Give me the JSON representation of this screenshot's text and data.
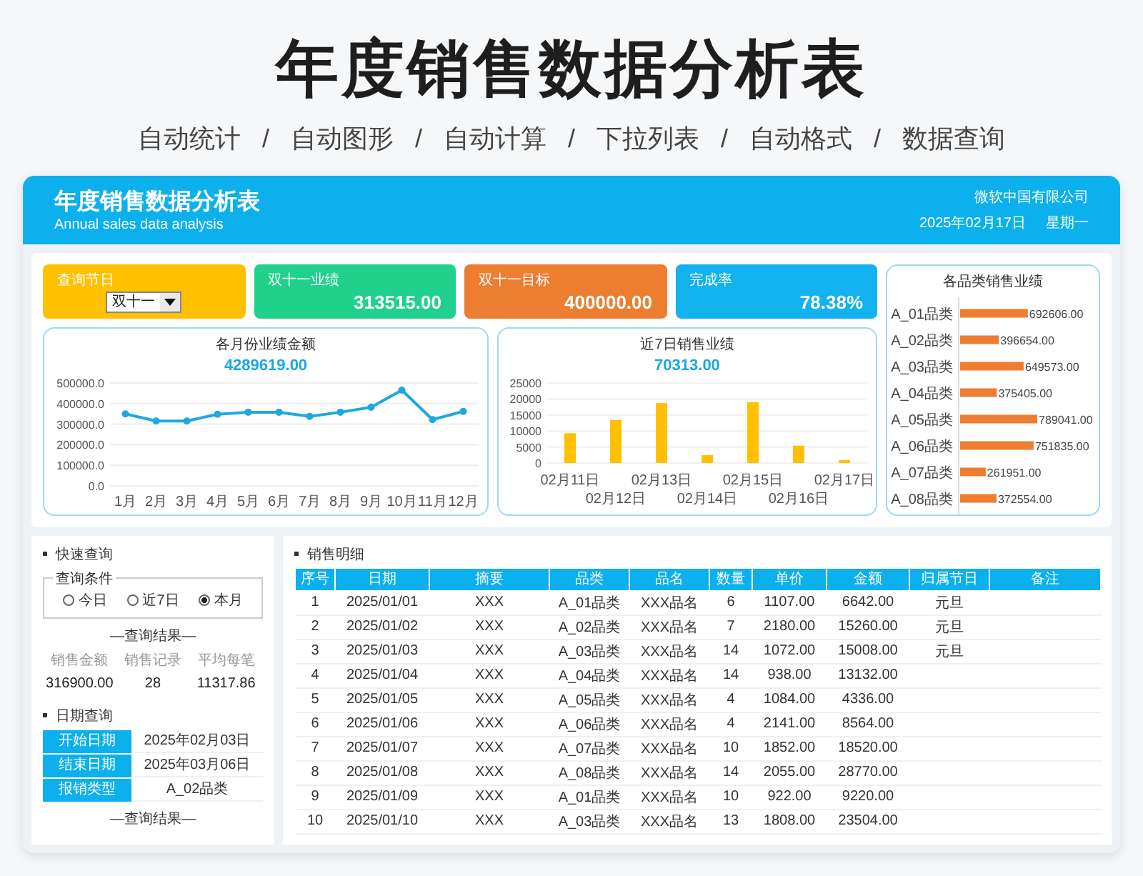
{
  "headline": {
    "title": "年度销售数据分析表",
    "features": "自动统计 / 自动图形 / 自动计算 / 下拉列表 / 自动格式 / 数据查询"
  },
  "header": {
    "title": "年度销售数据分析表",
    "subtitle": "Annual sales data analysis",
    "company": "微软中国有限公司",
    "date": "2025年02月17日",
    "weekday": "星期一"
  },
  "kpis": [
    {
      "kind": "select",
      "label": "查询节日",
      "value": "双十一",
      "color": "#ffc000"
    },
    {
      "kind": "metric",
      "label": "双十一业绩",
      "value": "313515.00",
      "color": "#1fd18a"
    },
    {
      "kind": "metric",
      "label": "双十一目标",
      "value": "400000.00",
      "color": "#ed7d31"
    },
    {
      "kind": "metric",
      "label": "完成率",
      "value": "78.38%",
      "color": "#12b2ee"
    }
  ],
  "monthly_chart": {
    "total": "4289619.00",
    "chart_data": {
      "type": "line",
      "title": "各月份业绩金额",
      "categories": [
        "1月",
        "2月",
        "3月",
        "4月",
        "5月",
        "6月",
        "7月",
        "8月",
        "9月",
        "10月",
        "11月",
        "12月"
      ],
      "grid": true,
      "series": [
        {
          "color": "#1fa8e0",
          "marker": true,
          "values": [
            350000,
            315000,
            315000,
            348000,
            358000,
            358000,
            338000,
            358000,
            382000,
            465000,
            322000,
            362000
          ]
        }
      ],
      "ylim": [
        0,
        500000
      ],
      "yticks": [
        {
          "value": 0,
          "label": "0.0"
        },
        {
          "value": 100000,
          "label": "100000.0"
        },
        {
          "value": 200000,
          "label": "200000.0"
        },
        {
          "value": 300000,
          "label": "300000.0"
        },
        {
          "value": 400000,
          "label": "400000.0"
        },
        {
          "value": 500000,
          "label": "500000.0"
        }
      ]
    }
  },
  "daily_chart": {
    "total": "70313.00",
    "chart_data": {
      "type": "bar",
      "title": "近7日销售业绩",
      "categories": [
        "02月11日",
        "02月12日",
        "02月13日",
        "02月14日",
        "02月15日",
        "02月16日",
        "02月17日"
      ],
      "grid": true,
      "series": [
        {
          "color": "#ffc000",
          "values": [
            9300,
            13400,
            18700,
            2500,
            19000,
            5400,
            900
          ]
        }
      ],
      "ylim": [
        0,
        25000
      ],
      "yticks": [
        0,
        5000,
        10000,
        15000,
        20000,
        25000
      ]
    }
  },
  "category_chart": {
    "chart_data": {
      "type": "bar",
      "orientation": "horizontal",
      "title": "各品类销售业绩",
      "categories": [
        "A_01品类",
        "A_02品类",
        "A_03品类",
        "A_04品类",
        "A_05品类",
        "A_06品类",
        "A_07品类",
        "A_08品类"
      ],
      "series": [
        {
          "color": "#ed7d31",
          "values": [
            692606,
            396654,
            649573,
            375405,
            789041,
            751835,
            261951,
            372554
          ],
          "value_labels": [
            "692606.00",
            "396654.00",
            "649573.00",
            "375405.00",
            "789041.00",
            "751835.00",
            "261951.00",
            "372554.00"
          ]
        }
      ]
    }
  },
  "quick_query": {
    "title": "快速查询",
    "legend": "查询条件",
    "options": [
      {
        "label": "今日",
        "selected": false
      },
      {
        "label": "近7日",
        "selected": false
      },
      {
        "label": "本月",
        "selected": true
      }
    ],
    "result_title": "—查询结果—",
    "metrics": [
      {
        "label": "销售金额",
        "value": "316900.00"
      },
      {
        "label": "销售记录",
        "value": "28"
      },
      {
        "label": "平均每笔",
        "value": "11317.86"
      }
    ]
  },
  "date_query": {
    "title": "日期查询",
    "fields": [
      {
        "label": "开始日期",
        "value": "2025年02月03日"
      },
      {
        "label": "结束日期",
        "value": "2025年03月06日"
      },
      {
        "label": "报销类型",
        "value": "A_02品类"
      }
    ],
    "result_title": "—查询结果—"
  },
  "sales_table": {
    "title": "销售明细",
    "columns": [
      "序号",
      "日期",
      "摘要",
      "品类",
      "品名",
      "数量",
      "单价",
      "金额",
      "归属节日",
      "备注"
    ],
    "rows": [
      [
        "1",
        "2025/01/01",
        "XXX",
        "A_01品类",
        "XXX品名",
        "6",
        "1107.00",
        "6642.00",
        "元旦"
      ],
      [
        "2",
        "2025/01/02",
        "XXX",
        "A_02品类",
        "XXX品名",
        "7",
        "2180.00",
        "15260.00",
        "元旦"
      ],
      [
        "3",
        "2025/01/03",
        "XXX",
        "A_03品类",
        "XXX品名",
        "14",
        "1072.00",
        "15008.00",
        "元旦"
      ],
      [
        "4",
        "2025/01/04",
        "XXX",
        "A_04品类",
        "XXX品名",
        "14",
        "938.00",
        "13132.00"
      ],
      [
        "5",
        "2025/01/05",
        "XXX",
        "A_05品类",
        "XXX品名",
        "4",
        "1084.00",
        "4336.00"
      ],
      [
        "6",
        "2025/01/06",
        "XXX",
        "A_06品类",
        "XXX品名",
        "4",
        "2141.00",
        "8564.00"
      ],
      [
        "7",
        "2025/01/07",
        "XXX",
        "A_07品类",
        "XXX品名",
        "10",
        "1852.00",
        "18520.00"
      ],
      [
        "8",
        "2025/01/08",
        "XXX",
        "A_08品类",
        "XXX品名",
        "14",
        "2055.00",
        "28770.00"
      ],
      [
        "9",
        "2025/01/09",
        "XXX",
        "A_01品类",
        "XXX品名",
        "10",
        "922.00",
        "9220.00"
      ],
      [
        "10",
        "2025/01/10",
        "XXX",
        "A_03品类",
        "XXX品名",
        "13",
        "1808.00",
        "23504.00"
      ]
    ]
  }
}
